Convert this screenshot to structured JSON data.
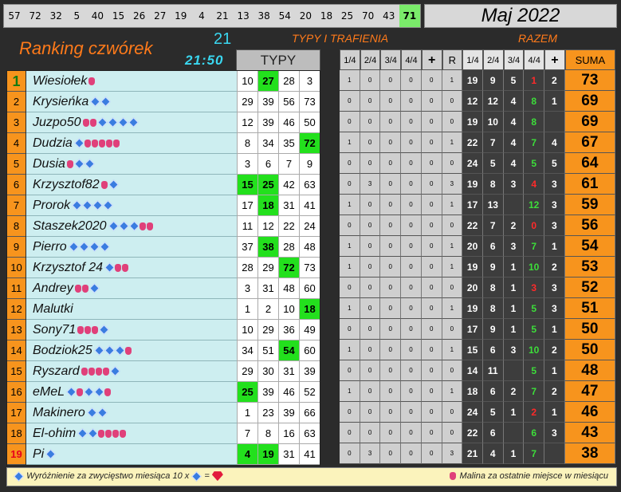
{
  "top_numbers": [
    "57",
    "72",
    "32",
    "5",
    "40",
    "15",
    "26",
    "27",
    "19",
    "4",
    "21",
    "13",
    "38",
    "54",
    "20",
    "18",
    "25",
    "70",
    "43",
    "71"
  ],
  "top_highlight": "71",
  "month": "Maj 2022",
  "title": "Ranking czwórek",
  "count": "21",
  "time": "21:50",
  "section_typy_trafienia": "TYPY I TRAFIENIA",
  "section_razem": "RAZEM",
  "typy_header": "TYPY",
  "stats_headers": [
    "1/4",
    "2/4",
    "3/4",
    "4/4",
    "+",
    "R",
    "1/4",
    "2/4",
    "3/4",
    "4/4",
    "+",
    "SUMA"
  ],
  "colors": {
    "orange": "#f7941d",
    "green_hit": "#23e01d",
    "cyan_text": "#3ad7f0",
    "name_bg": "#cdeef0"
  },
  "rows": [
    {
      "pos": "1",
      "name": "Wiesiołek",
      "marks": "b",
      "typy": [
        "10",
        "27",
        "28",
        "3"
      ],
      "hits": [
        1
      ],
      "stats": [
        "1",
        "0",
        "0",
        "0",
        "0",
        "1"
      ],
      "razem": [
        "19",
        "9",
        "5",
        "1",
        "2"
      ],
      "suma": "73"
    },
    {
      "pos": "2",
      "name": "Krysieńka",
      "marks": "dd",
      "typy": [
        "29",
        "39",
        "56",
        "73"
      ],
      "hits": [],
      "stats": [
        "0",
        "0",
        "0",
        "0",
        "0",
        "0"
      ],
      "razem": [
        "12",
        "12",
        "4",
        "8",
        "1"
      ],
      "suma": "69"
    },
    {
      "pos": "3",
      "name": "Juzpo50",
      "marks": "bbdddd",
      "typy": [
        "12",
        "39",
        "46",
        "50"
      ],
      "hits": [],
      "stats": [
        "0",
        "0",
        "0",
        "0",
        "0",
        "0"
      ],
      "razem": [
        "19",
        "10",
        "4",
        "8",
        ""
      ],
      "suma": "69"
    },
    {
      "pos": "4",
      "name": "Dudzia",
      "marks": "dbbbbb",
      "typy": [
        "8",
        "34",
        "35",
        "72"
      ],
      "hits": [
        3
      ],
      "stats": [
        "1",
        "0",
        "0",
        "0",
        "0",
        "1"
      ],
      "razem": [
        "22",
        "7",
        "4",
        "7",
        "4"
      ],
      "suma": "67"
    },
    {
      "pos": "5",
      "name": "Dusia",
      "marks": "bdd",
      "typy": [
        "3",
        "6",
        "7",
        "9"
      ],
      "hits": [],
      "stats": [
        "0",
        "0",
        "0",
        "0",
        "0",
        "0"
      ],
      "razem": [
        "24",
        "5",
        "4",
        "5",
        "5"
      ],
      "suma": "64"
    },
    {
      "pos": "6",
      "name": "Krzysztof82",
      "marks": "bd",
      "typy": [
        "15",
        "25",
        "42",
        "63"
      ],
      "hits": [
        0,
        1
      ],
      "stats": [
        "0",
        "3",
        "0",
        "0",
        "0",
        "3"
      ],
      "razem": [
        "19",
        "8",
        "3",
        "4",
        "3"
      ],
      "suma": "61"
    },
    {
      "pos": "7",
      "name": "Prorok",
      "marks": "dddd",
      "typy": [
        "17",
        "18",
        "31",
        "41"
      ],
      "hits": [
        1
      ],
      "stats": [
        "1",
        "0",
        "0",
        "0",
        "0",
        "1"
      ],
      "razem": [
        "17",
        "13",
        "",
        "12",
        "3"
      ],
      "suma": "59"
    },
    {
      "pos": "8",
      "name": "Staszek2020",
      "marks": "dddbb",
      "typy": [
        "11",
        "12",
        "22",
        "24"
      ],
      "hits": [],
      "stats": [
        "0",
        "0",
        "0",
        "0",
        "0",
        "0"
      ],
      "razem": [
        "22",
        "7",
        "2",
        "0",
        "3"
      ],
      "suma": "56"
    },
    {
      "pos": "9",
      "name": "Pierro",
      "marks": "dddd",
      "typy": [
        "37",
        "38",
        "28",
        "48"
      ],
      "hits": [
        1
      ],
      "stats": [
        "1",
        "0",
        "0",
        "0",
        "0",
        "1"
      ],
      "razem": [
        "20",
        "6",
        "3",
        "7",
        "1"
      ],
      "suma": "54"
    },
    {
      "pos": "10",
      "name": "Krzysztof 24",
      "marks": "dbb",
      "typy": [
        "28",
        "29",
        "72",
        "73"
      ],
      "hits": [
        2
      ],
      "stats": [
        "1",
        "0",
        "0",
        "0",
        "0",
        "1"
      ],
      "razem": [
        "19",
        "9",
        "1",
        "10",
        "2"
      ],
      "suma": "53"
    },
    {
      "pos": "11",
      "name": "Andrey",
      "marks": "bbd",
      "typy": [
        "3",
        "31",
        "48",
        "60"
      ],
      "hits": [],
      "stats": [
        "0",
        "0",
        "0",
        "0",
        "0",
        "0"
      ],
      "razem": [
        "20",
        "8",
        "1",
        "3",
        "3"
      ],
      "suma": "52"
    },
    {
      "pos": "12",
      "name": "Malutki",
      "marks": "",
      "typy": [
        "1",
        "2",
        "10",
        "18"
      ],
      "hits": [
        3
      ],
      "stats": [
        "1",
        "0",
        "0",
        "0",
        "0",
        "1"
      ],
      "razem": [
        "19",
        "8",
        "1",
        "5",
        "3"
      ],
      "suma": "51"
    },
    {
      "pos": "13",
      "name": "Sony71",
      "marks": "bbbd",
      "typy": [
        "10",
        "29",
        "36",
        "49"
      ],
      "hits": [],
      "stats": [
        "0",
        "0",
        "0",
        "0",
        "0",
        "0"
      ],
      "razem": [
        "17",
        "9",
        "1",
        "5",
        "1"
      ],
      "suma": "50"
    },
    {
      "pos": "14",
      "name": "Bodziok25",
      "marks": "dddb",
      "typy": [
        "34",
        "51",
        "54",
        "60"
      ],
      "hits": [
        2
      ],
      "stats": [
        "1",
        "0",
        "0",
        "0",
        "0",
        "1"
      ],
      "razem": [
        "15",
        "6",
        "3",
        "10",
        "2"
      ],
      "suma": "50"
    },
    {
      "pos": "15",
      "name": "Ryszard",
      "marks": "bbbbd",
      "typy": [
        "29",
        "30",
        "31",
        "39"
      ],
      "hits": [],
      "stats": [
        "0",
        "0",
        "0",
        "0",
        "0",
        "0"
      ],
      "razem": [
        "14",
        "11",
        "",
        "5",
        "1"
      ],
      "suma": "48"
    },
    {
      "pos": "16",
      "name": "eMeL",
      "marks": "dbddb",
      "typy": [
        "25",
        "39",
        "46",
        "52"
      ],
      "hits": [
        0
      ],
      "stats": [
        "1",
        "0",
        "0",
        "0",
        "0",
        "1"
      ],
      "razem": [
        "18",
        "6",
        "2",
        "7",
        "2"
      ],
      "suma": "47"
    },
    {
      "pos": "17",
      "name": "Makinero",
      "marks": "dd",
      "typy": [
        "1",
        "23",
        "39",
        "66"
      ],
      "hits": [],
      "stats": [
        "0",
        "0",
        "0",
        "0",
        "0",
        "0"
      ],
      "razem": [
        "24",
        "5",
        "1",
        "2",
        "1"
      ],
      "suma": "46"
    },
    {
      "pos": "18",
      "name": "El-ohim",
      "marks": "ddbbbb",
      "typy": [
        "7",
        "8",
        "16",
        "63"
      ],
      "hits": [],
      "stats": [
        "0",
        "0",
        "0",
        "0",
        "0",
        "0"
      ],
      "razem": [
        "22",
        "6",
        "",
        "6",
        "3"
      ],
      "suma": "43"
    },
    {
      "pos": "19",
      "name": "Pi",
      "marks": "d",
      "typy": [
        "4",
        "19",
        "31",
        "41"
      ],
      "hits": [
        0,
        1
      ],
      "stats": [
        "0",
        "3",
        "0",
        "0",
        "0",
        "3"
      ],
      "razem": [
        "21",
        "4",
        "1",
        "7",
        ""
      ],
      "suma": "38"
    }
  ],
  "red_cells": [
    [
      0,
      3
    ],
    [
      5,
      3
    ],
    [
      7,
      3
    ],
    [
      10,
      3
    ],
    [
      16,
      3
    ]
  ],
  "footer_left": "Wyróżnienie za zwycięstwo miesiąca",
  "footer_left_mult": "10 x",
  "footer_left_eq": "=",
  "footer_right": "Malina za ostatnie miejsce w miesiącu"
}
